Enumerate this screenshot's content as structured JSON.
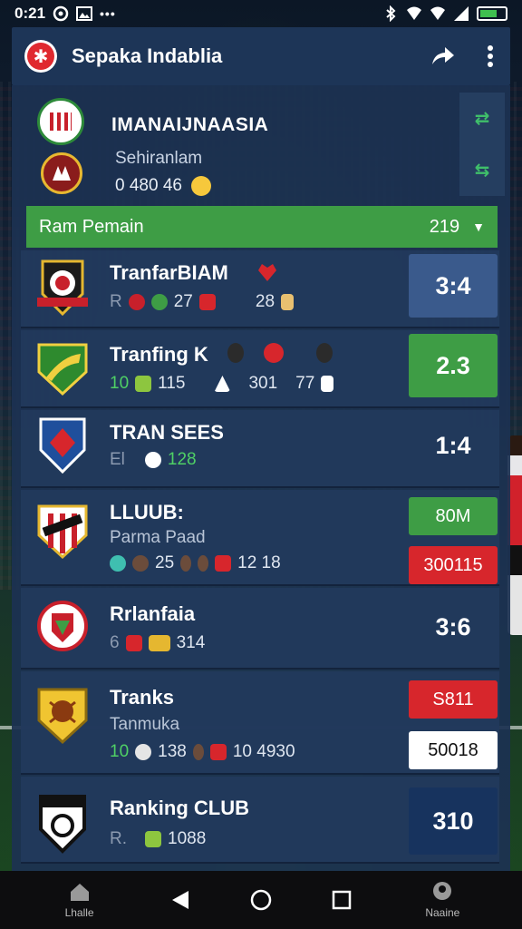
{
  "status_bar": {
    "time": "0:21"
  },
  "app_bar": {
    "title": "Sepaka Indablia"
  },
  "hero": {
    "title": "IMANAIJNAASIA",
    "subtitle": "Sehiranlam",
    "meta_value": "0  480 46"
  },
  "group_bar": {
    "label": "Ram Pemain",
    "count": "219"
  },
  "rows": [
    {
      "name": "TranfarBIAM",
      "sub": "",
      "meta": [
        "R",
        "27",
        "28"
      ],
      "score": "3:4"
    },
    {
      "name": "Tranfing  K",
      "sub": "",
      "meta": [
        "10",
        "115",
        "301",
        "77"
      ],
      "score": "2.3"
    },
    {
      "name": "TRAN SEES",
      "sub": "",
      "meta": [
        "El",
        "128"
      ],
      "score": "1:4"
    },
    {
      "name": "LLUUB:",
      "sub": "Parma Paad",
      "meta": [
        "25",
        "12 18"
      ],
      "pill_top": "80M",
      "pill_bottom": "300115"
    },
    {
      "name": "Rrlanfaia",
      "sub": "",
      "meta": [
        "6",
        "314"
      ],
      "score": "3:6"
    },
    {
      "name": "Tranks",
      "sub": "Tanmuka",
      "meta": [
        "10",
        "138",
        "10 4930"
      ],
      "pill_top": "S811",
      "pill_bottom": "50018"
    },
    {
      "name": "Ranking CLUB",
      "sub": "",
      "meta": [
        "R.",
        "1088"
      ],
      "score": "310"
    }
  ],
  "nav": {
    "left_label": "Lhalle",
    "right_label": "Naaine"
  },
  "colors": {
    "panel": "#1c3252",
    "green": "#3e9d45",
    "red": "#d7262c",
    "score_blue": "#3a5a8c",
    "dark_blue": "#17335e"
  }
}
